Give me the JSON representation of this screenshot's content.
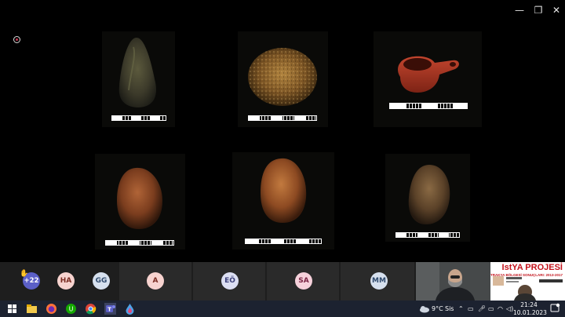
{
  "window": {
    "minimize_glyph": "—",
    "maximize_glyph": "❐",
    "close_glyph": "✕"
  },
  "stage": {
    "photos": [
      {
        "name": "stone-tool-elongated",
        "scale": "scale-bar"
      },
      {
        "name": "stone-round-porous",
        "scale": "scale-bar"
      },
      {
        "name": "ceramic-lamp-red",
        "scale": "scale-bar"
      },
      {
        "name": "stone-oval-reddish",
        "scale": "scale-bar"
      },
      {
        "name": "stone-oval-orange",
        "scale": "scale-bar"
      },
      {
        "name": "stone-oval-brown",
        "scale": "scale-bar"
      }
    ]
  },
  "participants": {
    "more_count": "+22",
    "avatars": [
      "HA",
      "GG",
      "A",
      "EÖ",
      "SA",
      "MM"
    ],
    "share_title": "IstYA PROJESİ",
    "share_subtitle": "TRAKYA BÖLGESİ SONUÇLARI: 2013-2017"
  },
  "taskbar": {
    "weather_temp": "9°C",
    "weather_text": "Sis",
    "time": "21:24",
    "date": "10.01.2023",
    "icons": [
      "windows-icon",
      "file-explorer-icon",
      "firefox-icon",
      "upwork-icon",
      "chrome-icon",
      "teams-icon",
      "droplet-app-icon"
    ]
  },
  "colors": {
    "accent": "#5b5fc7",
    "taskbar": "#1c2230",
    "recording": "#c4314b"
  }
}
